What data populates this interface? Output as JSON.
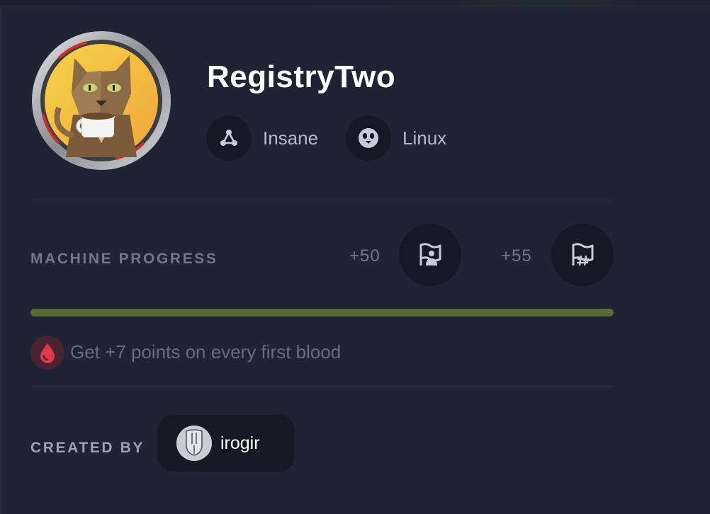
{
  "machine": {
    "name": "RegistryTwo",
    "difficulty": "Insane",
    "os": "Linux"
  },
  "progress": {
    "label": "MACHINE PROGRESS",
    "user_points": "+50",
    "root_points": "+55",
    "percent": 100,
    "bar_color": "#566b3a"
  },
  "first_blood": {
    "text": "Get +7 points on every first blood",
    "color": "#e23a4b"
  },
  "creator": {
    "label": "CREATED BY",
    "name": "irogir"
  },
  "icons": {
    "difficulty": "difficulty-nodes-icon",
    "os": "linux-penguin-icon",
    "user_flag": "user-flag-icon",
    "root_flag": "root-flag-icon",
    "blood": "blood-drop-icon"
  }
}
